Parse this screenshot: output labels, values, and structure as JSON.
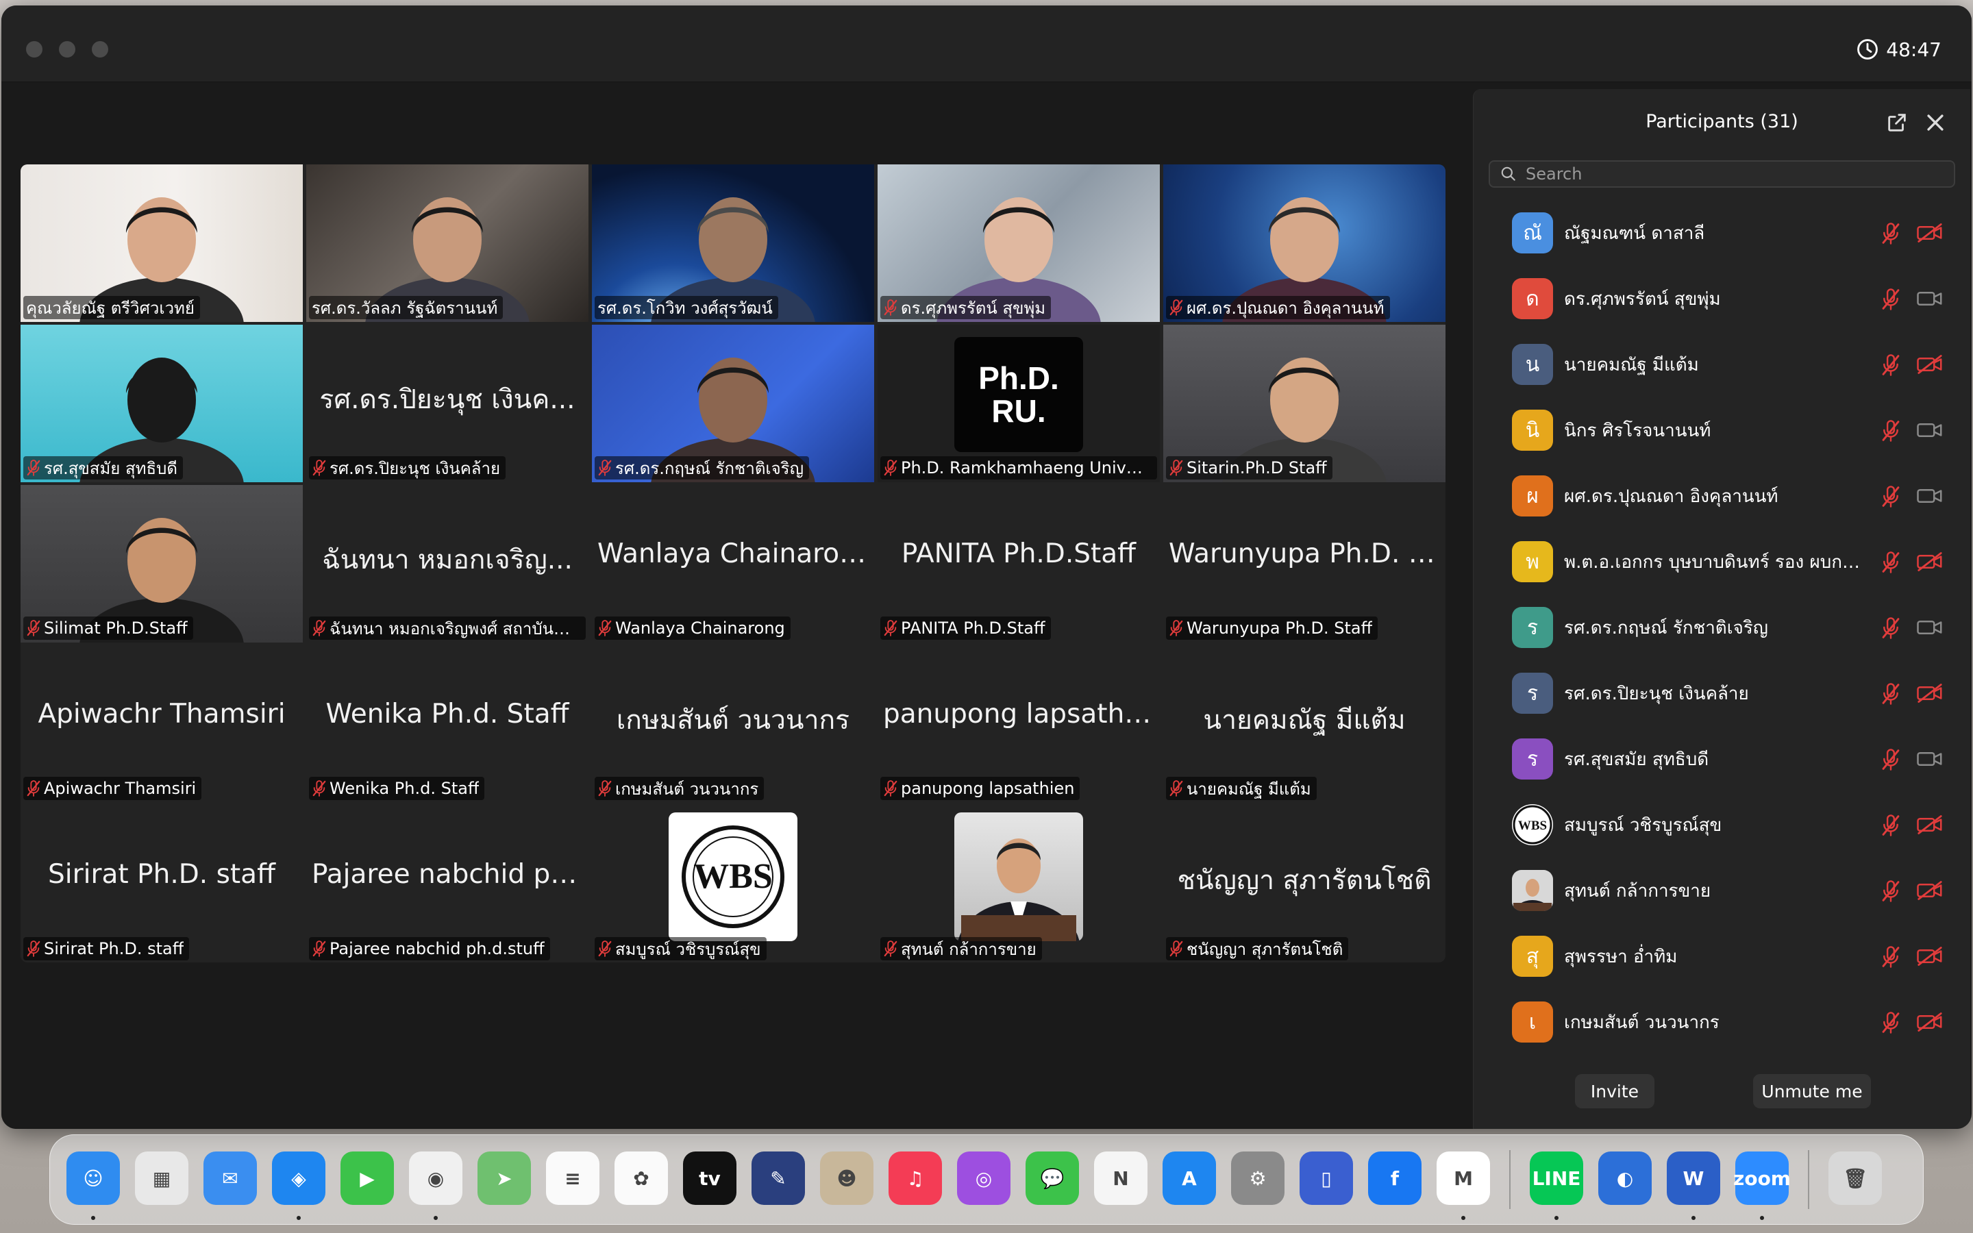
{
  "window": {
    "timer": "48:47"
  },
  "tiles": [
    {
      "name": "คุณวลัยณัฐ  ตรีวิศวเวทย์",
      "muted": false,
      "video": "logo-room"
    },
    {
      "name": "รศ.ดร.วัลลภ รัฐฉัตรานนท์",
      "muted": false,
      "video": "man-glasses",
      "speaking": true
    },
    {
      "name": "รศ.ดร.โกวิท  วงศ์สุรวัฒน์",
      "muted": false,
      "video": "earth"
    },
    {
      "name": "ดร.ศุภพรรัตน์  สุขพุ่ม",
      "muted": true,
      "video": "office"
    },
    {
      "name": "ผศ.ดร.ปุณณดา  อิงคุลานนท์",
      "muted": true,
      "video": "blue-bg"
    },
    {
      "name": "รศ.สุขสมัย สุทธิบดี",
      "muted": true,
      "video": "cyan-bg"
    },
    {
      "name": "รศ.ดร.ปิยะนุช  เงินคล้าย",
      "big": "รศ.ดร.ปิยะนุช  เงินค...",
      "muted": true
    },
    {
      "name": "รศ.ดร.กฤษณ์  รักชาติเจริญ",
      "muted": true,
      "video": "blue-bg2"
    },
    {
      "name": "Ph.D. Ramkhamhaeng University",
      "muted": true,
      "video": "phd-logo",
      "logo_text": "Ph.D. RU."
    },
    {
      "name": "Sitarin.Ph.D Staff",
      "muted": true,
      "video": "grey-bg"
    },
    {
      "name": "Silimat Ph.D.Staff",
      "muted": true,
      "video": "grey-bg2"
    },
    {
      "name": "ฉันทนา หมอกเจริญพงศ์ สถาบันมะเ...",
      "big": "ฉันทนา หมอกเจริญ...",
      "muted": true
    },
    {
      "name": "Wanlaya Chainarong",
      "big": "Wanlaya Chainarong",
      "muted": true
    },
    {
      "name": "PANITA Ph.D.Staff",
      "big": "PANITA Ph.D.Staff",
      "muted": true
    },
    {
      "name": "Warunyupa Ph.D. Staff",
      "big": "Warunyupa Ph.D. S...",
      "muted": true
    },
    {
      "name": "Apiwachr Thamsiri",
      "big": "Apiwachr Thamsiri",
      "muted": true
    },
    {
      "name": "Wenika Ph.d. Staff",
      "big": "Wenika Ph.d. Staff",
      "muted": true
    },
    {
      "name": "เกษมสันต์ วนวนากร",
      "big": "เกษมสันต์ วนวนากร",
      "muted": true
    },
    {
      "name": "panupong lapsathien",
      "big": "panupong lapsathi...",
      "muted": true
    },
    {
      "name": "นายคมณัฐ มีแต้ม",
      "big": "นายคมณัฐ มีแต้ม",
      "muted": true
    },
    {
      "name": "Sirirat Ph.D. staff",
      "big": "Sirirat Ph.D. staff",
      "muted": true
    },
    {
      "name": "Pajaree nabchid ph.d.stuff",
      "big": "Pajaree nabchid ph...",
      "muted": true
    },
    {
      "name": "สมบูรณ์ วชิรบูรณ์สุข",
      "muted": true,
      "video": "wbs-logo"
    },
    {
      "name": "สุทนต์ กล้าการขาย",
      "muted": true,
      "video": "portrait"
    },
    {
      "name": "ชนัญญา สุภารัตนโชติ",
      "big": "ชนัญญา สุภารัตนโชติ",
      "muted": true
    }
  ],
  "panel": {
    "title": "Participants (31)",
    "search_placeholder": "Search",
    "invite_label": "Invite",
    "unmute_label": "Unmute me",
    "participants": [
      {
        "initial": "ณั",
        "name": "ณัฐมณฑน์ ดาสาลี",
        "color": "#4a8fe0",
        "cam_off": true
      },
      {
        "initial": "ด",
        "name": "ดร.ศุภพรรัตน์  สุขพุ่ม",
        "color": "#e04b3c",
        "cam_off": false
      },
      {
        "initial": "น",
        "name": "นายคมณัฐ มีแต้ม",
        "color": "#4a5d7e",
        "cam_off": true
      },
      {
        "initial": "นิ",
        "name": "นิกร ศิรโรจนานนท์",
        "color": "#e6a71c",
        "cam_off": false
      },
      {
        "initial": "ผ",
        "name": "ผศ.ดร.ปุณณดา  อิงคุลานนท์",
        "color": "#e0701c",
        "cam_off": false
      },
      {
        "initial": "พ",
        "name": "พ.ต.อ.เอกกร บุษบาบดินทร์ รอง ผบก ต...",
        "color": "#e6b81c",
        "cam_off": true
      },
      {
        "initial": "ร",
        "name": "รศ.ดร.กฤษณ์  รักชาติเจริญ",
        "color": "#3f9b8a",
        "cam_off": false
      },
      {
        "initial": "ร",
        "name": "รศ.ดร.ปิยะนุช  เงินคล้าย",
        "color": "#4a5d7e",
        "cam_off": true
      },
      {
        "initial": "ร",
        "name": "รศ.สุขสมัย สุทธิบดี",
        "color": "#8a4fc0",
        "cam_off": false
      },
      {
        "initial": "WBS",
        "name": "สมบูรณ์ วชิรบูรณ์สุข",
        "color": "#ffffff",
        "cam_off": true
      },
      {
        "initial": "",
        "name": "สุทนต์ กล้าการขาย",
        "color": "#7a7a7a",
        "cam_off": true
      },
      {
        "initial": "สุ",
        "name": "สุพรรษา อ่ำทิม",
        "color": "#e6a71c",
        "cam_off": true
      },
      {
        "initial": "เ",
        "name": "เกษมสันต์ วนวนากร",
        "color": "#e0701c",
        "cam_off": true
      }
    ]
  },
  "dock": [
    {
      "name": "finder",
      "color": "#2f8cf0",
      "glyph": "☺",
      "dot": true
    },
    {
      "name": "launchpad",
      "color": "#e8e8e8",
      "glyph": "▦",
      "dot": false
    },
    {
      "name": "mail",
      "color": "#3a8ef0",
      "glyph": "✉",
      "dot": false
    },
    {
      "name": "safari",
      "color": "#1e86f0",
      "glyph": "◈",
      "dot": true
    },
    {
      "name": "facetime",
      "color": "#3cc24a",
      "glyph": "▶",
      "dot": false
    },
    {
      "name": "chrome",
      "color": "#f0f0f0",
      "glyph": "◉",
      "dot": true
    },
    {
      "name": "maps",
      "color": "#6fc06f",
      "glyph": "➤",
      "dot": false
    },
    {
      "name": "reminders",
      "color": "#fafafa",
      "glyph": "≡",
      "dot": false
    },
    {
      "name": "photos",
      "color": "#fafafa",
      "glyph": "✿",
      "dot": false
    },
    {
      "name": "tv",
      "color": "#111111",
      "glyph": "tv",
      "dot": false
    },
    {
      "name": "notes-app",
      "color": "#2a3f7e",
      "glyph": "✎",
      "dot": false
    },
    {
      "name": "contacts",
      "color": "#c8b79a",
      "glyph": "☻",
      "dot": false
    },
    {
      "name": "music",
      "color": "#f43c55",
      "glyph": "♫",
      "dot": false
    },
    {
      "name": "podcasts",
      "color": "#9d4fe0",
      "glyph": "◎",
      "dot": false
    },
    {
      "name": "messages",
      "color": "#3cc24a",
      "glyph": "💬",
      "dot": false
    },
    {
      "name": "news",
      "color": "#f5f5f5",
      "glyph": "N",
      "dot": false
    },
    {
      "name": "app-store",
      "color": "#1e86f0",
      "glyph": "A",
      "dot": false
    },
    {
      "name": "system-settings",
      "color": "#8a8a8a",
      "glyph": "⚙",
      "dot": false
    },
    {
      "name": "simulator",
      "color": "#3a5fd0",
      "glyph": "▯",
      "dot": false
    },
    {
      "name": "facebook",
      "color": "#1877f2",
      "glyph": "f",
      "dot": false
    },
    {
      "name": "gmail",
      "color": "#ffffff",
      "glyph": "M",
      "dot": true
    },
    {
      "name": "line",
      "color": "#06c755",
      "glyph": "LINE",
      "dot": true
    },
    {
      "name": "webcam-app",
      "color": "#2c6fd8",
      "glyph": "◐",
      "dot": false
    },
    {
      "name": "word",
      "color": "#2b5fc7",
      "glyph": "W",
      "dot": true
    },
    {
      "name": "zoom",
      "color": "#2d8cff",
      "glyph": "zoom",
      "dot": true
    },
    {
      "name": "trash",
      "color": "#d8d8d8",
      "glyph": "🗑",
      "dot": false
    }
  ]
}
